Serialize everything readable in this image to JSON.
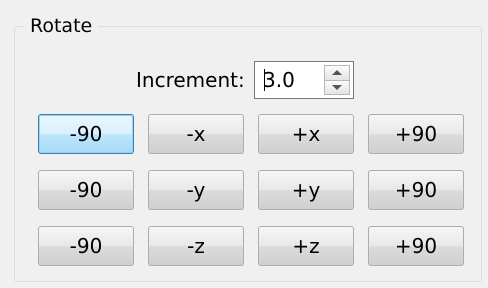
{
  "group": {
    "title": "Rotate"
  },
  "increment": {
    "label": "Increment:",
    "value": "3.0"
  },
  "rows": [
    {
      "axis": "x",
      "buttons": [
        "-90",
        "-x",
        "+x",
        "+90"
      ]
    },
    {
      "axis": "y",
      "buttons": [
        "-90",
        "-y",
        "+y",
        "+90"
      ]
    },
    {
      "axis": "z",
      "buttons": [
        "-90",
        "-z",
        "+z",
        "+90"
      ]
    }
  ]
}
